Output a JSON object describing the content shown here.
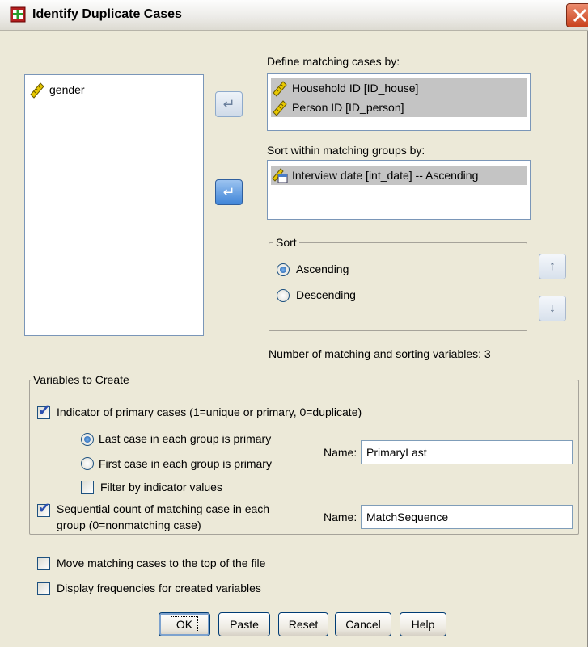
{
  "window": {
    "title": "Identify Duplicate Cases"
  },
  "source_list": {
    "items": [
      "gender"
    ]
  },
  "matching": {
    "label": "Define matching cases by:",
    "items": [
      "Household ID [ID_house]",
      "Person ID [ID_person]"
    ]
  },
  "sorting": {
    "label": "Sort within matching groups by:",
    "items": [
      "Interview date [int_date] -- Ascending"
    ]
  },
  "sort_group": {
    "legend": "Sort",
    "ascending": "Ascending",
    "descending": "Descending",
    "selected": "Ascending"
  },
  "count_text": "Number of matching and sorting variables:  3",
  "create_group": {
    "legend": "Variables to Create",
    "indicator_label": "Indicator of primary cases (1=unique or primary, 0=duplicate)",
    "indicator_checked": true,
    "last_case_label": "Last case in each group is primary",
    "first_case_label": "First case in each group is primary",
    "primary_selected": "last",
    "filter_label": "Filter by indicator values",
    "filter_checked": false,
    "name_label": "Name:",
    "primary_name": "PrimaryLast",
    "sequential_label_1": "Sequential count of matching case in each",
    "sequential_label_2": "group (0=nonmatching case)",
    "sequential_checked": true,
    "sequence_name": "MatchSequence"
  },
  "options": {
    "move_label": "Move matching cases to the top of the file",
    "move_checked": false,
    "freq_label": "Display frequencies for created variables",
    "freq_checked": false
  },
  "buttons": {
    "ok": "OK",
    "paste": "Paste",
    "reset": "Reset",
    "cancel": "Cancel",
    "help": "Help"
  },
  "icons": {
    "variable": "ruler-icon",
    "date_variable": "calendar-ruler-icon",
    "app": "spss-dialog-icon"
  }
}
